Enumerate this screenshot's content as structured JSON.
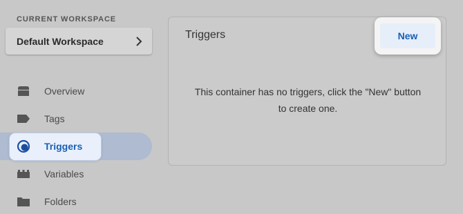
{
  "sidebar": {
    "workspace_section_label": "CURRENT WORKSPACE",
    "workspace_name": "Default Workspace",
    "items": [
      {
        "label": "Overview",
        "icon": "overview-icon"
      },
      {
        "label": "Tags",
        "icon": "tag-icon"
      },
      {
        "label": "Triggers",
        "icon": "trigger-icon",
        "active": true
      },
      {
        "label": "Variables",
        "icon": "variables-icon"
      },
      {
        "label": "Folders",
        "icon": "folder-icon"
      }
    ]
  },
  "main": {
    "card_title": "Triggers",
    "new_button_label": "New",
    "empty_message_line1": "This container has no triggers, click the \"New\" button",
    "empty_message_line2": "to create one."
  },
  "colors": {
    "accent": "#1a5fb4",
    "background": "#c8c8c8",
    "active_band": "#aebbd0"
  }
}
